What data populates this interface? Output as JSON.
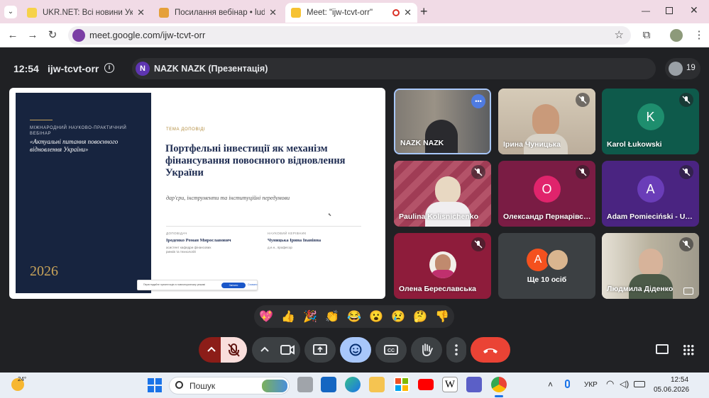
{
  "browser": {
    "tabs": [
      {
        "title": "UKR.NET: Всі новини України, ",
        "active": false
      },
      {
        "title": "Посилання вебінар • luda_dide",
        "active": false
      },
      {
        "title": "Meet: \"ijw-tcvt-orr\"",
        "active": true
      }
    ],
    "url": "meet.google.com/ijw-tcvt-orr"
  },
  "meet": {
    "time": "12:54",
    "code": "ijw-tcvt-orr",
    "presenter_initial": "N",
    "presenter_name": "NAZK NAZK (Презентація)",
    "participant_count": "19"
  },
  "slide": {
    "kicker": "Міжнародний науково-практичний вебінар",
    "conference": "«Актуальні питання повоєнного відновлення України»",
    "year": "2026",
    "label": "ТЕМА ДОПОВІДІ",
    "title": "Портфельні інвестиції як механізм фінансування повоєнного відновлення України",
    "subtitle": "дар'єри, інструменти та інституційні передумови",
    "speaker_label": "ДОПОВІДАЧ",
    "speaker_name": "Іроденко Роман Мирославович",
    "speaker_desc": "асистент кафедри фінансових ринків та технологій",
    "advisor_label": "НАУКОВИЙ КЕРІВНИК",
    "advisor_name": "Чуницька Ірина Іванівна",
    "advisor_desc": "д.е.н., професор",
    "caption_text": "Переглядайте презентацію в повноекранному режимі",
    "caption_button": "Змінити",
    "caption_link": "Сховати"
  },
  "participants": [
    {
      "name": "NAZK NAZK",
      "initial": "",
      "color": "#5a6270"
    },
    {
      "name": "Ірина Чуницька",
      "initial": "",
      "color": "#b8a596"
    },
    {
      "name": "Karol Łukowski",
      "initial": "K",
      "color": "#1e8e6e"
    },
    {
      "name": "Paulina Kolisnichenko",
      "initial": "",
      "color": "#b35a6e"
    },
    {
      "name": "Олександр Пернарівсь...",
      "initial": "О",
      "color": "#e0246c"
    },
    {
      "name": "Adam Pomieciński - Uni...",
      "initial": "A",
      "color": "#6a3db8"
    },
    {
      "name": "Олена Береславська",
      "initial": "",
      "color": "#c0306e"
    },
    {
      "name": "Ще 10 осіб",
      "initial": "А",
      "color": "#f4511e"
    },
    {
      "name": "Людмила Діденко",
      "initial": "",
      "color": "#c7bfae"
    }
  ],
  "reactions": [
    "💖",
    "👍",
    "🎉",
    "👏",
    "😂",
    "😮",
    "😢",
    "🤔",
    "👎"
  ],
  "taskbar": {
    "weather": "24°",
    "search_placeholder": "Пошук",
    "lang": "УКР",
    "time": "12:54",
    "date": "05.06.2026"
  },
  "colors": {
    "meet_bg": "#202124",
    "end_call": "#ea4335",
    "mic_off": "#f9dedc",
    "active_control": "#a8c7fa"
  }
}
